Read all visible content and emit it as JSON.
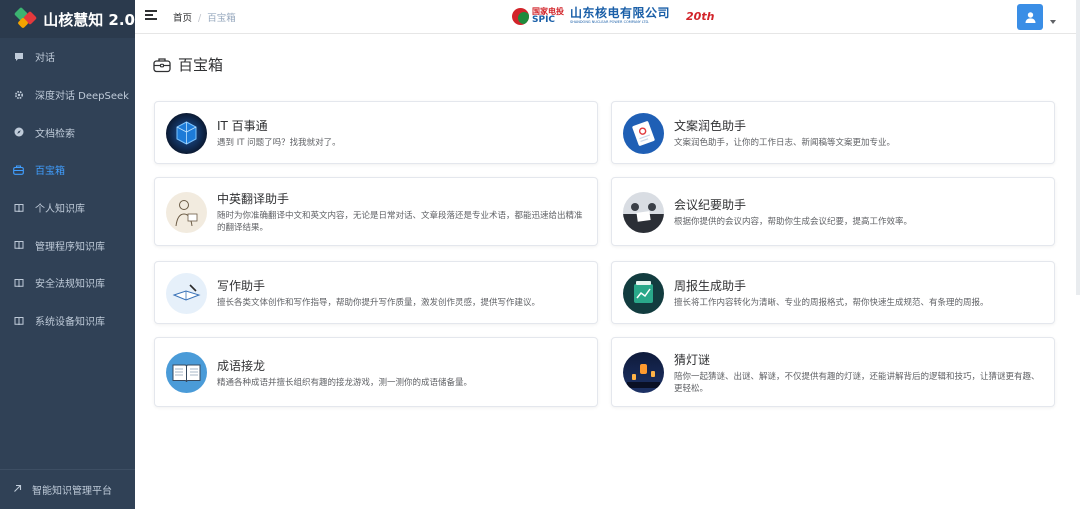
{
  "app": {
    "title": "山核慧知 2.0"
  },
  "sidebar": {
    "items": [
      {
        "label": "对话",
        "icon": "chat-icon"
      },
      {
        "label": "深度对话 DeepSeek",
        "icon": "gear-icon"
      },
      {
        "label": "文档检索",
        "icon": "compass-icon"
      },
      {
        "label": "百宝箱",
        "icon": "toolbox-icon",
        "active": true
      },
      {
        "label": "个人知识库",
        "icon": "book-icon"
      },
      {
        "label": "管理程序知识库",
        "icon": "book-icon"
      },
      {
        "label": "安全法规知识库",
        "icon": "book-icon"
      },
      {
        "label": "系统设备知识库",
        "icon": "book-icon"
      }
    ],
    "footer": {
      "label": "智能知识管理平台",
      "icon": "arrow-up-right-icon"
    }
  },
  "header": {
    "breadcrumb": {
      "home": "首页",
      "current": "百宝箱"
    },
    "logo": {
      "abbr_cn": "国家电投",
      "abbr_en": "SPIC",
      "name_cn": "山东核电有限公司",
      "name_en": "SHANDONG NUCLEAR POWER COMPANY LTD.",
      "anniversary": "20th"
    }
  },
  "page": {
    "title": "百宝箱",
    "cards": [
      {
        "title": "IT 百事通",
        "desc": "遇到 IT 问题了吗？找我就对了。",
        "thumb": "it-cube"
      },
      {
        "title": "文案润色助手",
        "desc": "文案润色助手，让你的工作日志、新闻稿等文案更加专业。",
        "thumb": "document"
      },
      {
        "title": "中英翻译助手",
        "desc": "随时为你准确翻译中文和英文内容，无论是日常对话、文章段落还是专业术语，都能迅速给出精准的翻译结果。",
        "thumb": "sketch-person"
      },
      {
        "title": "会议纪要助手",
        "desc": "根据你提供的会议内容，帮助你生成会议纪要，提高工作效率。",
        "thumb": "meeting"
      },
      {
        "title": "写作助手",
        "desc": "擅长各类文体创作和写作指导，帮助你提升写作质量，激发创作灵感，提供写作建议。",
        "thumb": "writing-book"
      },
      {
        "title": "周报生成助手",
        "desc": "擅长将工作内容转化为清晰、专业的周报格式，帮你快速生成规范、有条理的周报。",
        "thumb": "report-board"
      },
      {
        "title": "成语接龙",
        "desc": "精通各种成语并擅长组织有趣的接龙游戏，测一测你的成语储备量。",
        "thumb": "open-book"
      },
      {
        "title": "猜灯谜",
        "desc": "陪你一起猜谜、出谜、解谜，不仅提供有趣的灯谜，还能讲解背后的逻辑和技巧，让猜谜更有趣、更轻松。",
        "thumb": "lanterns"
      }
    ]
  }
}
